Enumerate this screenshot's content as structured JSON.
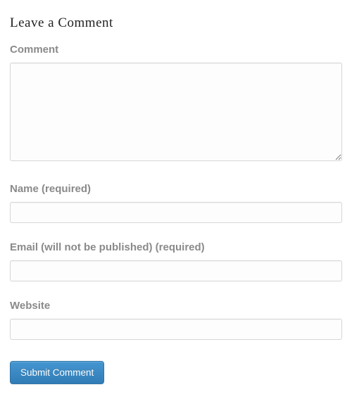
{
  "form": {
    "title": "Leave a Comment",
    "comment": {
      "label": "Comment",
      "value": ""
    },
    "name": {
      "label": "Name (required)",
      "value": ""
    },
    "email": {
      "label": "Email (will not be published) (required)",
      "value": ""
    },
    "website": {
      "label": "Website",
      "value": ""
    },
    "submit_label": "Submit Comment"
  }
}
